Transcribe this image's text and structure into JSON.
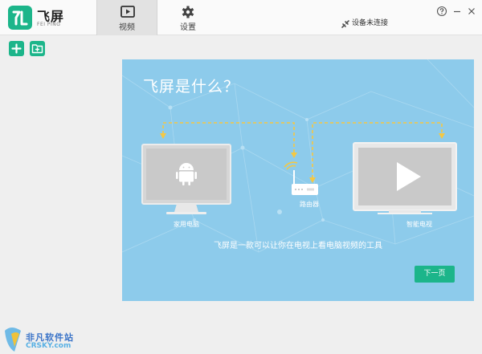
{
  "app": {
    "name": "飞屏",
    "subtitle": "FEI PING"
  },
  "nav": {
    "tabs": [
      {
        "label": "视频",
        "icon": "video-icon",
        "active": true
      },
      {
        "label": "设置",
        "icon": "gear-icon",
        "active": false
      }
    ]
  },
  "device_status": {
    "label": "设备未连接",
    "icon": "disconnected-icon"
  },
  "window_controls": [
    "help-icon",
    "minimize-icon",
    "close-icon"
  ],
  "toolbar": {
    "buttons": [
      {
        "icon": "plus-icon"
      },
      {
        "icon": "add-folder-icon"
      }
    ]
  },
  "intro": {
    "title": "飞屏是什么？",
    "devices": {
      "pc": "家用电脑",
      "router": "路由器",
      "tv": "智能电视"
    },
    "description": "飞屏是一款可以让你在电视上看电脑视频的工具",
    "next_label": "下一页"
  },
  "watermark": {
    "cn": "非凡软件站",
    "en": "CRSKY.com"
  },
  "colors": {
    "brand_green": "#1cb58a",
    "panel_blue": "#8dcbeb",
    "dashed_arrow": "#f5c842",
    "device_gray": "#c9c9c9"
  }
}
